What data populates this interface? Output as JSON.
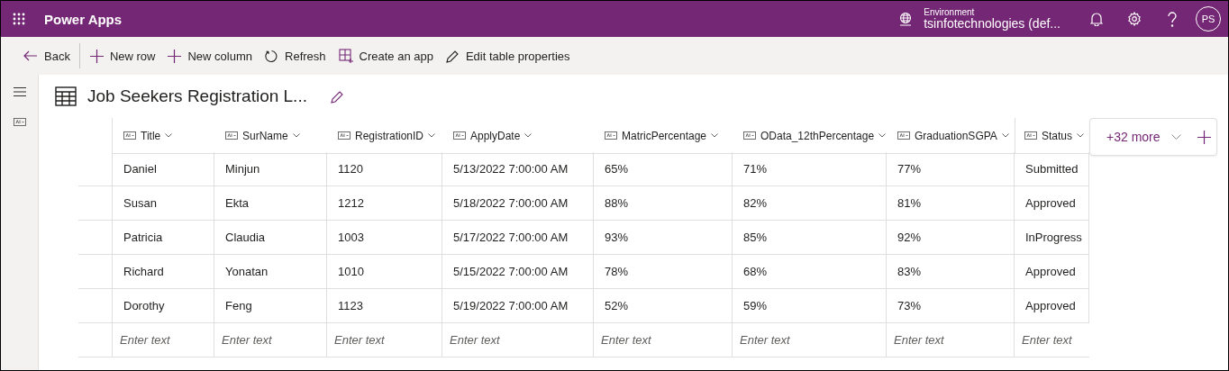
{
  "app": {
    "title": "Power Apps"
  },
  "environment": {
    "label": "Environment",
    "name": "tsinfotechnologies (def..."
  },
  "user": {
    "initials": "PS"
  },
  "commands": [
    {
      "label": "Back",
      "kind": "back"
    },
    {
      "label": "New row",
      "kind": "add"
    },
    {
      "label": "New column",
      "kind": "add"
    },
    {
      "label": "Refresh",
      "kind": "refresh"
    },
    {
      "label": "Create an app",
      "kind": "app"
    },
    {
      "label": "Edit table properties",
      "kind": "edit"
    }
  ],
  "table": {
    "title": "Job Seekers Registration L...",
    "columns": [
      "Title",
      "SurName",
      "RegistrationID",
      "ApplyDate",
      "MatricPercentage",
      "OData_12thPercentage",
      "GraduationSGPA",
      "Status"
    ],
    "more_columns": "+32 more",
    "rows": [
      [
        "Daniel",
        "Minjun",
        "1120",
        "5/13/2022 7:00:00 AM",
        "65%",
        "71%",
        "77%",
        "Submitted"
      ],
      [
        "Susan",
        "Ekta",
        "1212",
        "5/18/2022 7:00:00 AM",
        "88%",
        "82%",
        "81%",
        "Approved"
      ],
      [
        "Patricia",
        "Claudia",
        "1003",
        "5/17/2022 7:00:00 AM",
        "93%",
        "85%",
        "92%",
        "InProgress"
      ],
      [
        "Richard",
        "Yonatan",
        "1010",
        "5/15/2022 7:00:00 AM",
        "78%",
        "68%",
        "83%",
        "Approved"
      ],
      [
        "Dorothy",
        "Feng",
        "1123",
        "5/19/2022 7:00:00 AM",
        "52%",
        "59%",
        "73%",
        "Approved"
      ]
    ],
    "new_row_placeholders": [
      "Enter text",
      "Enter text",
      "Enter text",
      "Enter text",
      "Enter text",
      "Enter text",
      "Enter text",
      "Enter text"
    ]
  }
}
